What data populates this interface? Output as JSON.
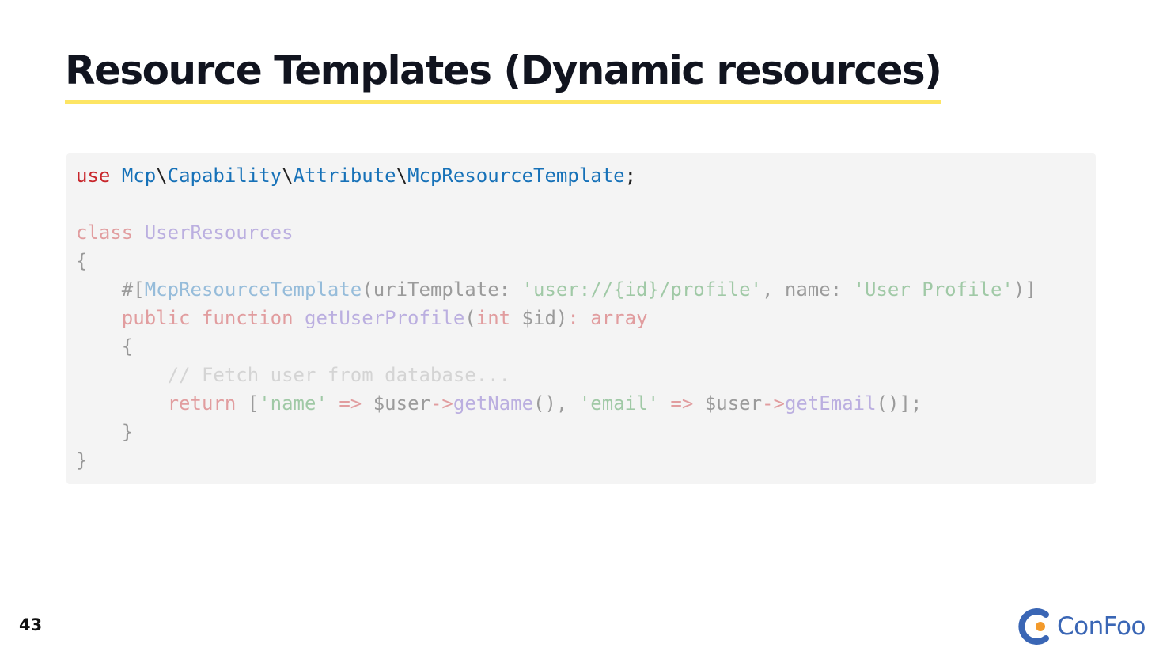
{
  "slide": {
    "title": "Resource Templates (Dynamic resources)",
    "page_number": "43"
  },
  "code": {
    "line1": {
      "use": "use",
      "ns1": "Mcp",
      "sep1": "\\",
      "ns2": "Capability",
      "sep2": "\\",
      "ns3": "Attribute",
      "sep3": "\\",
      "ns4": "McpResourceTemplate",
      "semi": ";"
    },
    "line3": {
      "class_kw": "class",
      "class_name": "UserResources"
    },
    "line4": "{",
    "line5": {
      "attr_open": "    #[",
      "attr_name": "McpResourceTemplate",
      "arg1": "(uriTemplate: ",
      "str1": "'user://{id}/profile'",
      "arg2": ", name: ",
      "str2": "'User Profile'",
      "attr_close": ")]"
    },
    "line6": {
      "indent": "    ",
      "public_kw": "public",
      "function_kw": "function",
      "method": "getUserProfile",
      "paren_open": "(",
      "int_kw": "int",
      "param": " $id)",
      "colon": ":",
      "array_kw": "array"
    },
    "line7": "    {",
    "line8": "        // Fetch user from database...",
    "line9": {
      "indent": "        ",
      "return_kw": "return",
      "bracket_open": " [",
      "str_name": "'name'",
      "arrow1": " =>",
      "var1": " $user",
      "op1": "->",
      "call1": "getName",
      "paren1": "(), ",
      "str_email": "'email'",
      "arrow2": " =>",
      "var2": " $user",
      "op2": "->",
      "call2": "getEmail",
      "end": "()];"
    },
    "line10": "    }",
    "line11": "}"
  },
  "logo": {
    "text": "ConFoo",
    "icon": "confoo-logo-icon"
  },
  "colors": {
    "title_underline": "#fde564",
    "code_background": "#f4f4f4",
    "keyword": "#c8262b",
    "namespace": "#1671b8",
    "logo_blue": "#3a66b5",
    "logo_orange": "#f39a2b"
  }
}
